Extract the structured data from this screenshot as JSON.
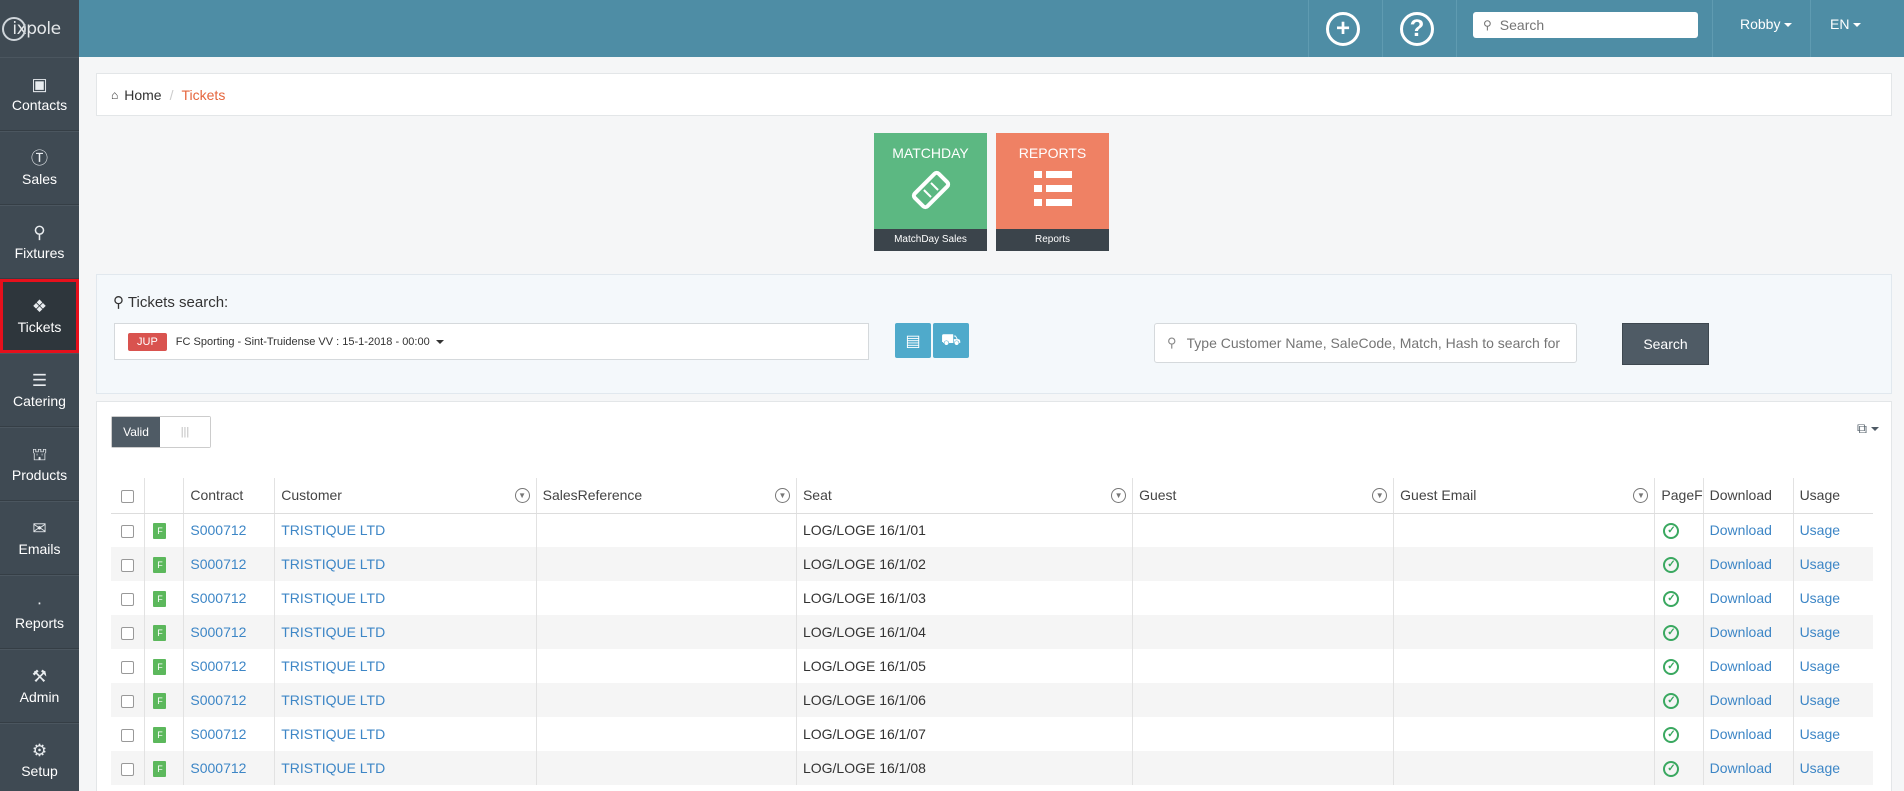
{
  "app": {
    "logo_text": "ixpole"
  },
  "sidebar": {
    "items": [
      {
        "label": "Contacts",
        "icon": "contact-card-icon"
      },
      {
        "label": "Sales",
        "icon": "dollar-icon"
      },
      {
        "label": "Fixtures",
        "icon": "trophy-icon"
      },
      {
        "label": "Tickets",
        "icon": "ticket-icon",
        "active": true
      },
      {
        "label": "Catering",
        "icon": "cutlery-icon"
      },
      {
        "label": "Products",
        "icon": "cart-icon"
      },
      {
        "label": "Emails",
        "icon": "envelope-icon"
      },
      {
        "label": "Reports",
        "icon": "chart-icon"
      },
      {
        "label": "Admin",
        "icon": "tools-icon"
      },
      {
        "label": "Setup",
        "icon": "gears-icon"
      }
    ]
  },
  "topbar": {
    "search_placeholder": "Search",
    "user": "Robby",
    "language": "EN"
  },
  "breadcrumb": {
    "home": "Home",
    "current": "Tickets"
  },
  "tiles": {
    "matchday": {
      "title": "MATCHDAY",
      "footer": "MatchDay Sales",
      "color": "#5cb882"
    },
    "reports": {
      "title": "REPORTS",
      "footer": "Reports",
      "color": "#ef8164"
    }
  },
  "search": {
    "title": "Tickets search:",
    "badge": "JUP",
    "selected_match": "FC Sporting - Sint-Truidense VV : 15-1-2018 - 00:00",
    "placeholder": "Type Customer Name, SaleCode, Match, Hash to search for",
    "button": "Search"
  },
  "table": {
    "toggle_on": "Valid",
    "toggle_off": "|||",
    "headers": {
      "contract": "Contract",
      "customer": "Customer",
      "sales_reference": "SalesReference",
      "seat": "Seat",
      "guest": "Guest",
      "guest_email": "Guest Email",
      "page": "PageF",
      "download": "Download",
      "usage": "Usage"
    },
    "rows": [
      {
        "badge": "F",
        "contract": "S000712",
        "customer": "TRISTIQUE LTD",
        "sales_reference": "",
        "seat": "LOG/LOGE 16/1/01",
        "guest": "",
        "guest_email": "",
        "download": "Download",
        "usage": "Usage"
      },
      {
        "badge": "F",
        "contract": "S000712",
        "customer": "TRISTIQUE LTD",
        "sales_reference": "",
        "seat": "LOG/LOGE 16/1/02",
        "guest": "",
        "guest_email": "",
        "download": "Download",
        "usage": "Usage"
      },
      {
        "badge": "F",
        "contract": "S000712",
        "customer": "TRISTIQUE LTD",
        "sales_reference": "",
        "seat": "LOG/LOGE 16/1/03",
        "guest": "",
        "guest_email": "",
        "download": "Download",
        "usage": "Usage"
      },
      {
        "badge": "F",
        "contract": "S000712",
        "customer": "TRISTIQUE LTD",
        "sales_reference": "",
        "seat": "LOG/LOGE 16/1/04",
        "guest": "",
        "guest_email": "",
        "download": "Download",
        "usage": "Usage"
      },
      {
        "badge": "F",
        "contract": "S000712",
        "customer": "TRISTIQUE LTD",
        "sales_reference": "",
        "seat": "LOG/LOGE 16/1/05",
        "guest": "",
        "guest_email": "",
        "download": "Download",
        "usage": "Usage"
      },
      {
        "badge": "F",
        "contract": "S000712",
        "customer": "TRISTIQUE LTD",
        "sales_reference": "",
        "seat": "LOG/LOGE 16/1/06",
        "guest": "",
        "guest_email": "",
        "download": "Download",
        "usage": "Usage"
      },
      {
        "badge": "F",
        "contract": "S000712",
        "customer": "TRISTIQUE LTD",
        "sales_reference": "",
        "seat": "LOG/LOGE 16/1/07",
        "guest": "",
        "guest_email": "",
        "download": "Download",
        "usage": "Usage"
      },
      {
        "badge": "F",
        "contract": "S000712",
        "customer": "TRISTIQUE LTD",
        "sales_reference": "",
        "seat": "LOG/LOGE 16/1/08",
        "guest": "",
        "guest_email": "",
        "download": "Download",
        "usage": "Usage"
      }
    ]
  }
}
